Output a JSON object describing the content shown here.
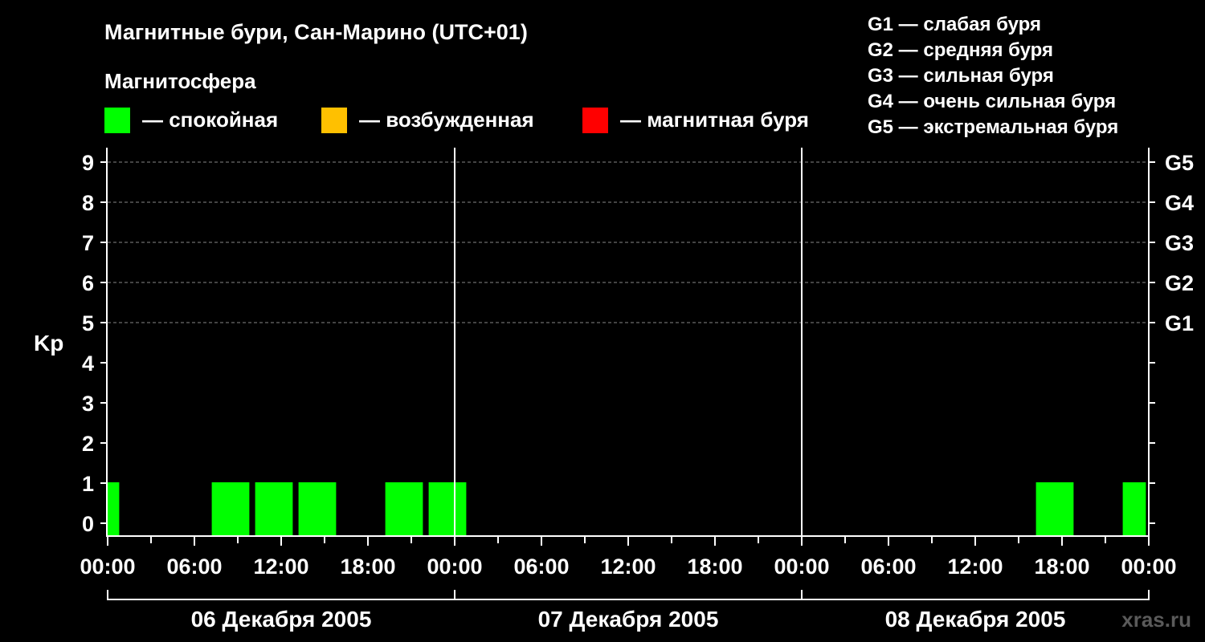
{
  "title": "Магнитные бури, Сан-Марино (UTC+01)",
  "magnetosphere_label": "Магнитосфера",
  "legend": [
    {
      "label": "— спокойная",
      "color": "#00ff00"
    },
    {
      "label": "— возбужденная",
      "color": "#ffc000"
    },
    {
      "label": "— магнитная буря",
      "color": "#ff0000"
    }
  ],
  "g_legend": [
    "G1 — слабая буря",
    "G2 — средняя буря",
    "G3 — сильная буря",
    "G4 — очень сильная буря",
    "G5 — экстремальная буря"
  ],
  "watermark": "xras.ru",
  "chart_data": {
    "type": "bar",
    "ylabel": "Kp",
    "ylim": [
      0,
      9
    ],
    "y_ticks": [
      0,
      1,
      2,
      3,
      4,
      5,
      6,
      7,
      8,
      9
    ],
    "g_scale": [
      {
        "label": "G1",
        "kp": 5
      },
      {
        "label": "G2",
        "kp": 6
      },
      {
        "label": "G3",
        "kp": 7
      },
      {
        "label": "G4",
        "kp": 8
      },
      {
        "label": "G5",
        "kp": 9
      }
    ],
    "x_range_hours": [
      0,
      72
    ],
    "x_tick_labels": [
      "00:00",
      "06:00",
      "12:00",
      "18:00",
      "00:00",
      "06:00",
      "12:00",
      "18:00",
      "00:00",
      "06:00",
      "12:00",
      "18:00",
      "00:00"
    ],
    "days": [
      "06 Декабря 2005",
      "07 Декабря 2005",
      "08 Декабря 2005"
    ],
    "grid": "dashed horizontal at Kp 5–9",
    "series": [
      {
        "values": [
          {
            "start": 0.0,
            "end": 0.8,
            "kp": 1,
            "level": "quiet"
          },
          {
            "start": 7.2,
            "end": 9.8,
            "kp": 1,
            "level": "quiet"
          },
          {
            "start": 10.2,
            "end": 12.8,
            "kp": 1,
            "level": "quiet"
          },
          {
            "start": 13.2,
            "end": 15.8,
            "kp": 1,
            "level": "quiet"
          },
          {
            "start": 19.2,
            "end": 21.8,
            "kp": 1,
            "level": "quiet"
          },
          {
            "start": 22.2,
            "end": 24.8,
            "kp": 1,
            "level": "quiet"
          },
          {
            "start": 64.2,
            "end": 66.8,
            "kp": 1,
            "level": "quiet"
          },
          {
            "start": 70.2,
            "end": 71.8,
            "kp": 1,
            "level": "quiet"
          }
        ]
      }
    ]
  }
}
